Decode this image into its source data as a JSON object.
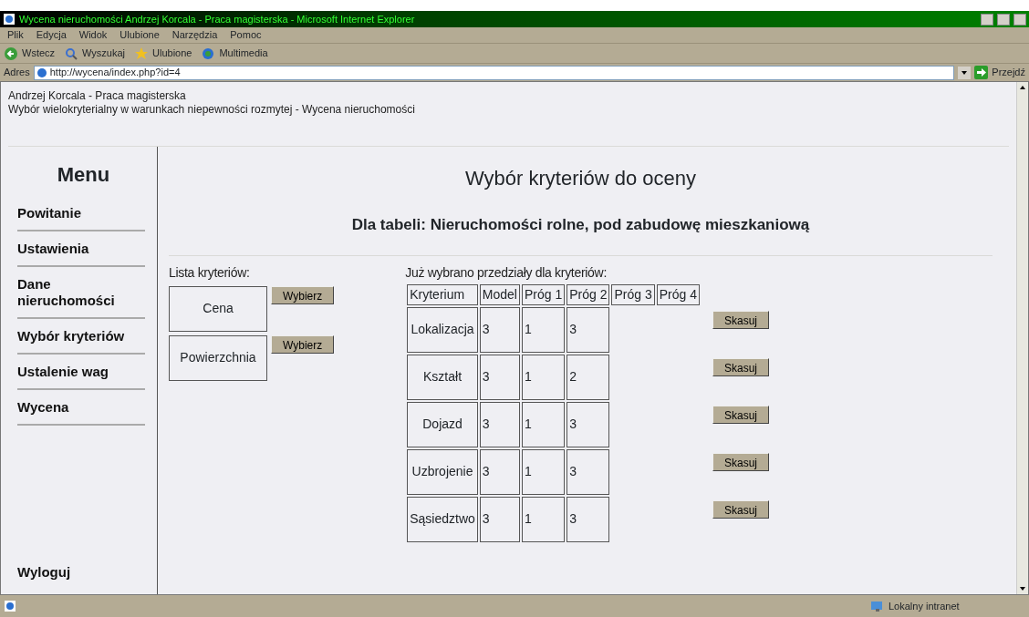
{
  "window": {
    "title": "Wycena nieruchomości Andrzej Korcala - Praca magisterska - Microsoft Internet Explorer"
  },
  "menubar": [
    "Plik",
    "Edycja",
    "Widok",
    "Ulubione",
    "Narzędzia",
    "Pomoc"
  ],
  "toolbar": [
    {
      "kind": "back",
      "label": "Wstecz"
    },
    {
      "kind": "search",
      "label": "Wyszukaj"
    },
    {
      "kind": "favorites",
      "label": "Ulubione"
    },
    {
      "kind": "media",
      "label": "Multimedia"
    }
  ],
  "address": {
    "label": "Adres",
    "url": "http://wycena/index.php?id=4",
    "go": "Przejdź"
  },
  "header": [
    "Andrzej Korcala - Praca magisterska",
    "Wybór wielokryterialny w warunkach niepewności rozmytej - Wycena nieruchomości"
  ],
  "sidebar": {
    "title": "Menu",
    "items": [
      {
        "label": "Powitanie"
      },
      {
        "label": "Ustawienia"
      },
      {
        "label": "Dane nieruchomości"
      },
      {
        "label": "Wybór kryteriów"
      },
      {
        "label": "Ustalenie wag"
      },
      {
        "label": "Wycena"
      }
    ],
    "logout": "Wyloguj"
  },
  "page": {
    "title": "Wybór kryteriów do oceny",
    "subtitle": "Dla tabeli: Nieruchomości rolne, pod zabudowę mieszkaniową"
  },
  "criteria": {
    "label": "Lista kryteriów:",
    "items": [
      {
        "name": "Cena",
        "button": "Wybierz"
      },
      {
        "name": "Powierzchnia",
        "button": "Wybierz"
      }
    ]
  },
  "table": {
    "label": "Już wybrano przedziały dla kryteriów:",
    "columns": [
      "Kryterium",
      "Model",
      "Próg 1",
      "Próg 2",
      "Próg 3",
      "Próg 4"
    ],
    "rows": [
      {
        "cells": [
          "Lokalizacja",
          "3",
          "1",
          "3"
        ],
        "button": "Skasuj"
      },
      {
        "cells": [
          "Kształt",
          "3",
          "1",
          "2"
        ],
        "button": "Skasuj"
      },
      {
        "cells": [
          "Dojazd",
          "3",
          "1",
          "3"
        ],
        "button": "Skasuj"
      },
      {
        "cells": [
          "Uzbrojenie",
          "3",
          "1",
          "3"
        ],
        "button": "Skasuj"
      },
      {
        "cells": [
          "Sąsiedztwo",
          "3",
          "1",
          "3"
        ],
        "button": "Skasuj"
      }
    ]
  },
  "status_bar": {
    "zone": "Lokalny intranet"
  }
}
